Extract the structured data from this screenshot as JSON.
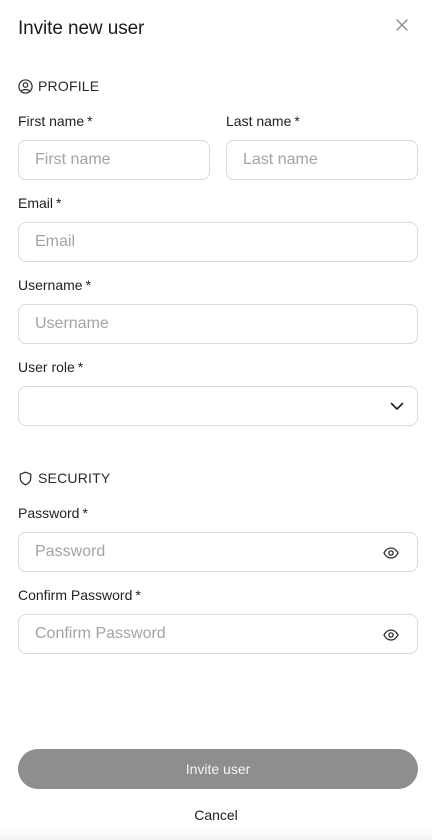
{
  "dialog": {
    "title": "Invite new user"
  },
  "profile": {
    "section_label": "PROFILE",
    "first_name": {
      "label": "First name",
      "required": "*",
      "placeholder": "First name",
      "value": ""
    },
    "last_name": {
      "label": "Last name",
      "required": "*",
      "placeholder": "Last name",
      "value": ""
    },
    "email": {
      "label": "Email",
      "required": "*",
      "placeholder": "Email",
      "value": ""
    },
    "username": {
      "label": "Username",
      "required": "*",
      "placeholder": "Username",
      "value": ""
    },
    "user_role": {
      "label": "User role",
      "required": "*",
      "selected": ""
    }
  },
  "security": {
    "section_label": "SECURITY",
    "password": {
      "label": "Password",
      "required": "*",
      "placeholder": "Password",
      "value": ""
    },
    "confirm_password": {
      "label": "Confirm Password",
      "required": "*",
      "placeholder": "Confirm Password",
      "value": ""
    }
  },
  "actions": {
    "invite_label": "Invite user",
    "cancel_label": "Cancel"
  },
  "icons": {
    "close": "close-icon",
    "profile": "user-circle-icon",
    "security": "shield-icon",
    "chevron": "chevron-down-icon",
    "eye": "eye-icon"
  },
  "colors": {
    "primary_button_disabled": "#8e8e8e",
    "border": "#d9d9d9",
    "placeholder": "#a3a3a3",
    "text": "#1f1f1f"
  }
}
